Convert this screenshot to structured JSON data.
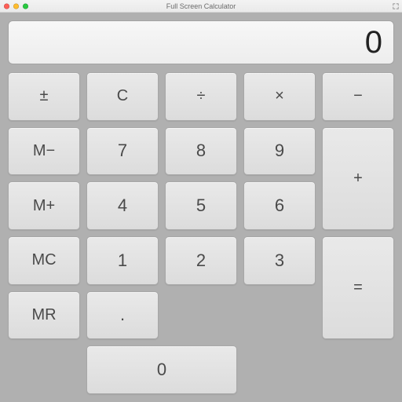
{
  "window": {
    "title": "Full Screen Calculator"
  },
  "display": {
    "value": "0"
  },
  "keys": {
    "plusminus": "±",
    "clear": "C",
    "divide": "÷",
    "multiply": "×",
    "minus": "−",
    "plus": "+",
    "equals": "=",
    "decimal": ".",
    "mem_minus": "M−",
    "mem_plus": "M+",
    "mem_clear": "MC",
    "mem_recall": "MR",
    "n0": "0",
    "n1": "1",
    "n2": "2",
    "n3": "3",
    "n4": "4",
    "n5": "5",
    "n6": "6",
    "n7": "7",
    "n8": "8",
    "n9": "9"
  }
}
